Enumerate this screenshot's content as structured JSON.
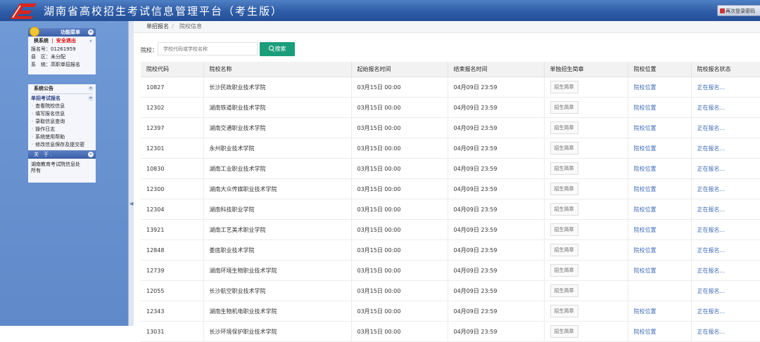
{
  "header": {
    "title": "湖南省高校招生考试信息管理平台（考生版）",
    "right_button": "再次登录密码"
  },
  "sidebar": {
    "func_panel": {
      "title": "功能菜单",
      "switch_system": "换系统",
      "divider": "|",
      "safe_exit": "安全退出",
      "info": [
        {
          "label": "报名号：",
          "value": "01261959"
        },
        {
          "label": "县　区：",
          "value": "未分配"
        },
        {
          "label": "系　统：",
          "value": "高职单招报名"
        }
      ]
    },
    "system_panel": {
      "title": "系统公告",
      "menu_title": "单招考试报名",
      "items": [
        "查看院校信息",
        "填写报名信息",
        "录取信息查询",
        "操作日志",
        "系统使用帮助",
        "修改信息保存及提交密"
      ],
      "about_title": "关　于 .",
      "about_text_1": "湖南教育考试院信息处",
      "about_text_2": "所有"
    }
  },
  "breadcrumb": {
    "item1": "单招报名",
    "separator": "/",
    "item2": "院校信息"
  },
  "search": {
    "label": "院校：",
    "placeholder": "学校代码或学校名称",
    "button_label": "搜索"
  },
  "table": {
    "headers": [
      "院校代码",
      "院校名称",
      "起始报名时间",
      "结束报名时间",
      "单独招生简章",
      "院校位置",
      "院校报名状态"
    ],
    "guide_label": "招生简章",
    "rows": [
      {
        "code": "10827",
        "name": "长沙民政职业技术学院",
        "start": "03月15日 00:00",
        "end": "04月09日 23:59",
        "location": "院校位置",
        "status": "正在报名..."
      },
      {
        "code": "12302",
        "name": "湖南铁道职业技术学院",
        "start": "03月15日 00:00",
        "end": "04月09日 23:59",
        "location": "院校位置",
        "status": "正在报名..."
      },
      {
        "code": "12397",
        "name": "湖南交通职业技术学院",
        "start": "03月15日 00:00",
        "end": "04月09日 23:59",
        "location": "院校位置",
        "status": "正在报名..."
      },
      {
        "code": "12301",
        "name": "永州职业技术学院",
        "start": "03月15日 00:00",
        "end": "04月09日 23:59",
        "location": "院校位置",
        "status": "正在报名..."
      },
      {
        "code": "10830",
        "name": "湖南工业职业技术学院",
        "start": "03月15日 00:00",
        "end": "04月09日 23:59",
        "location": "院校位置",
        "status": "正在报名..."
      },
      {
        "code": "12300",
        "name": "湖南大众传媒职业技术学院",
        "start": "03月15日 00:00",
        "end": "04月09日 23:59",
        "location": "院校位置",
        "status": "正在报名..."
      },
      {
        "code": "12304",
        "name": "湖南科技职业学院",
        "start": "03月15日 00:00",
        "end": "04月09日 23:59",
        "location": "院校位置",
        "status": "正在报名..."
      },
      {
        "code": "13921",
        "name": "湖南工艺美术职业学院",
        "start": "03月15日 00:00",
        "end": "04月09日 23:59",
        "location": "院校位置",
        "status": "正在报名..."
      },
      {
        "code": "12848",
        "name": "娄底职业技术学院",
        "start": "03月15日 00:00",
        "end": "04月09日 23:59",
        "location": "院校位置",
        "status": "正在报名..."
      },
      {
        "code": "12739",
        "name": "湖南环境生物职业技术学院",
        "start": "03月15日 00:00",
        "end": "04月09日 23:59",
        "location": "院校位置",
        "status": "正在报名..."
      },
      {
        "code": "12055",
        "name": "长沙航空职业技术学院",
        "start": "03月15日 00:00",
        "end": "04月09日 23:59",
        "location": "",
        "status": "正在报名..."
      },
      {
        "code": "12343",
        "name": "湖南生物机电职业技术学院",
        "start": "03月15日 00:00",
        "end": "04月09日 23:59",
        "location": "院校位置",
        "status": "正在报名..."
      },
      {
        "code": "13031",
        "name": "长沙环境保护职业技术学院",
        "start": "03月15日 00:00",
        "end": "04月09日 23:59",
        "location": "院校位置",
        "status": "正在报名..."
      }
    ]
  },
  "colors": {
    "header": "#2e5ca6",
    "sidebar": "#6f9ad6",
    "accent": "#1b9e7c",
    "link": "#3d6bb8"
  }
}
